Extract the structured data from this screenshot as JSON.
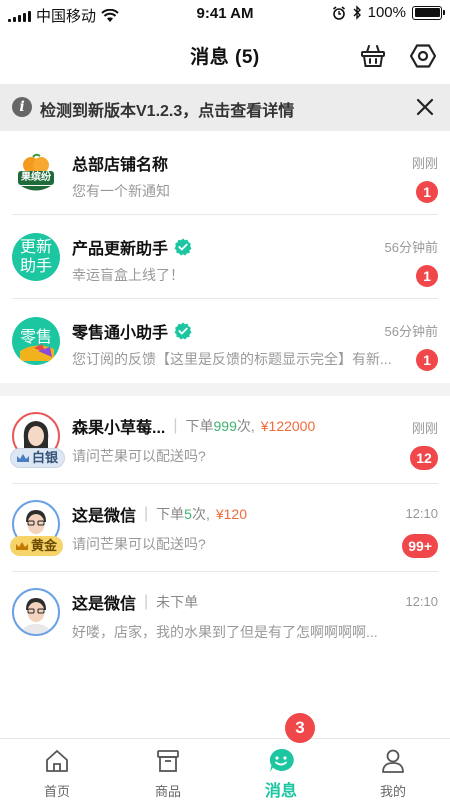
{
  "status_bar": {
    "carrier": "中国移动",
    "time": "9:41 AM",
    "battery": "100%"
  },
  "header": {
    "title": "消息 (5)"
  },
  "banner": {
    "text": "检测到新版本V1.2.3，点击查看详情"
  },
  "system_messages": [
    {
      "title": "总部店铺名称",
      "subtitle": "您有一个新通知",
      "time": "刚刚",
      "badge": "1",
      "avatar_text": "果缤纷",
      "verified": false
    },
    {
      "title": "产品更新助手",
      "subtitle": "幸运盲盒上线了！",
      "time": "56分钟前",
      "badge": "1",
      "avatar_text": "更新\n助手",
      "verified": true
    },
    {
      "title": "零售通小助手",
      "subtitle": "您订阅的反馈【这里是反馈的标题显示完全】有新...",
      "time": "56分钟前",
      "badge": "1",
      "avatar_text": "零售",
      "verified": true
    }
  ],
  "chats": [
    {
      "name": "森果小草莓...",
      "orders_prefix": "下单",
      "orders_count": "999",
      "orders_suffix": "次,",
      "amount": "¥122000",
      "time": "刚刚",
      "message": "请问芒果可以配送吗?",
      "badge": "12",
      "level": "白银"
    },
    {
      "name": "这是微信",
      "orders_prefix": "下单",
      "orders_count": "5",
      "orders_suffix": "次,",
      "amount": "¥120",
      "time": "12:10",
      "message": "请问芒果可以配送吗?",
      "badge": "99+",
      "level": "黄金"
    },
    {
      "name": "这是微信",
      "orders_prefix": "未下单",
      "orders_count": "",
      "orders_suffix": "",
      "amount": "",
      "time": "12:10",
      "message": "好喽，店家，我的水果到了但是有了怎啊啊啊啊...",
      "badge": "",
      "level": ""
    }
  ],
  "floating_badge": "3",
  "tabs": [
    {
      "label": "首页",
      "icon": "home-icon",
      "active": false
    },
    {
      "label": "商品",
      "icon": "box-icon",
      "active": false
    },
    {
      "label": "消息",
      "icon": "message-icon",
      "active": true
    },
    {
      "label": "我的",
      "icon": "user-icon",
      "active": false
    }
  ],
  "colors": {
    "accent": "#1cc6a0",
    "badge": "#f0474b",
    "amount": "#f06a3a",
    "orders_count": "#3cb371"
  }
}
